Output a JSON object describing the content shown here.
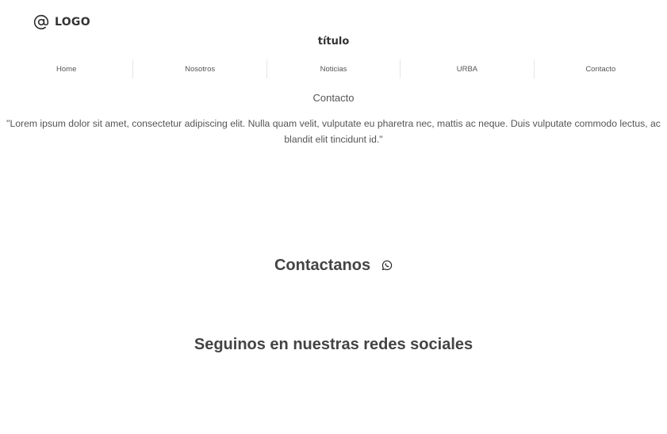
{
  "header": {
    "logo_icon": "at-sign-icon",
    "logo_text": "LOGO",
    "site_title": "título"
  },
  "nav": {
    "items": [
      {
        "label": "Home"
      },
      {
        "label": "Nosotros"
      },
      {
        "label": "Noticias"
      },
      {
        "label": "URBA"
      },
      {
        "label": "Contacto"
      }
    ]
  },
  "main": {
    "heading": "Contacto",
    "intro": "\"Lorem ipsum dolor sit amet, consectetur adipiscing elit. Nulla quam velit, vulputate eu pharetra nec, mattis ac neque. Duis vulputate commodo lectus, ac blandit elit tincidunt id.\"",
    "contact_title": "Contactanos",
    "contact_icon": "whatsapp-icon",
    "social_title": "Seguinos en nuestras redes sociales"
  },
  "colors": {
    "text": "#444444",
    "divider": "#e6e6e6",
    "background": "#ffffff"
  }
}
